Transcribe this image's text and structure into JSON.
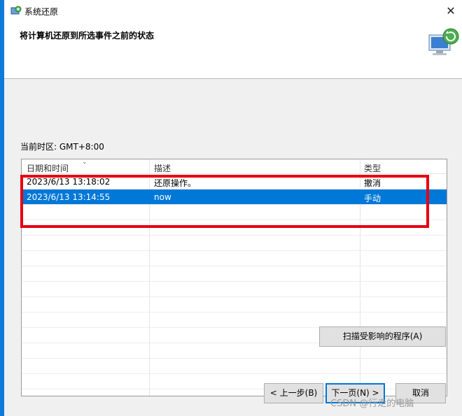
{
  "window": {
    "title": "系统还原"
  },
  "header": {
    "title": "将计算机还原到所选事件之前的状态"
  },
  "timezone": {
    "label": "当前时区: GMT+8:00"
  },
  "table": {
    "columns": [
      "日期和时间",
      "描述",
      "类型"
    ],
    "rows": [
      [
        "2023/6/13 13:18:02",
        "还原操作。",
        "撤消"
      ],
      [
        "2023/6/13 13:14:55",
        "now",
        "手动"
      ]
    ],
    "selected_row": 1
  },
  "buttons": {
    "scan": "扫描受影响的程序(A)",
    "back": "< 上一步(B)",
    "next": "下一页(N) >",
    "cancel": "取消"
  },
  "watermark": "CSDN @行走的电脑",
  "colors": {
    "accent": "#0f7ad8",
    "selection": "#0078d7",
    "annotation": "#e60012"
  }
}
